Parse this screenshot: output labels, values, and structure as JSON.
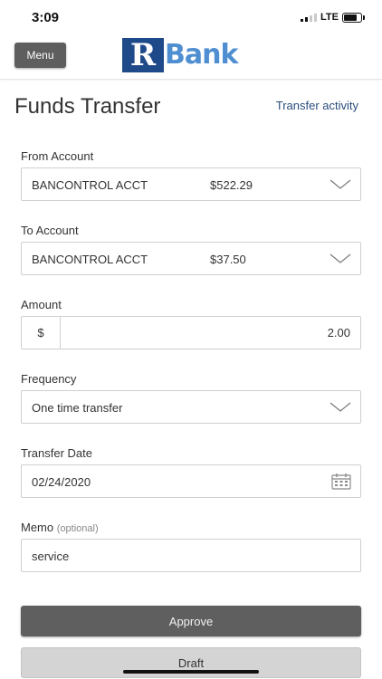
{
  "status_bar": {
    "time": "3:09",
    "network": "LTE"
  },
  "header": {
    "menu_label": "Menu",
    "logo_letter": "R",
    "logo_text": "Bank"
  },
  "page": {
    "title": "Funds Transfer",
    "activity_link": "Transfer activity"
  },
  "form": {
    "from_account": {
      "label": "From Account",
      "account": "BANCONTROL ACCT",
      "balance": "$522.29"
    },
    "to_account": {
      "label": "To Account",
      "account": "BANCONTROL ACCT",
      "balance": "$37.50"
    },
    "amount": {
      "label": "Amount",
      "currency": "$",
      "value": "2.00"
    },
    "frequency": {
      "label": "Frequency",
      "value": "One time transfer"
    },
    "transfer_date": {
      "label": "Transfer Date",
      "value": "02/24/2020"
    },
    "memo": {
      "label": "Memo",
      "optional": "(optional)",
      "value": "service"
    }
  },
  "actions": {
    "approve": "Approve",
    "draft": "Draft"
  },
  "colors": {
    "brand_dark": "#1f4a8a",
    "brand_light": "#4f8fd1",
    "link": "#2a4d7c",
    "primary_button": "#5f5f5f",
    "secondary_button": "#d4d4d4"
  }
}
